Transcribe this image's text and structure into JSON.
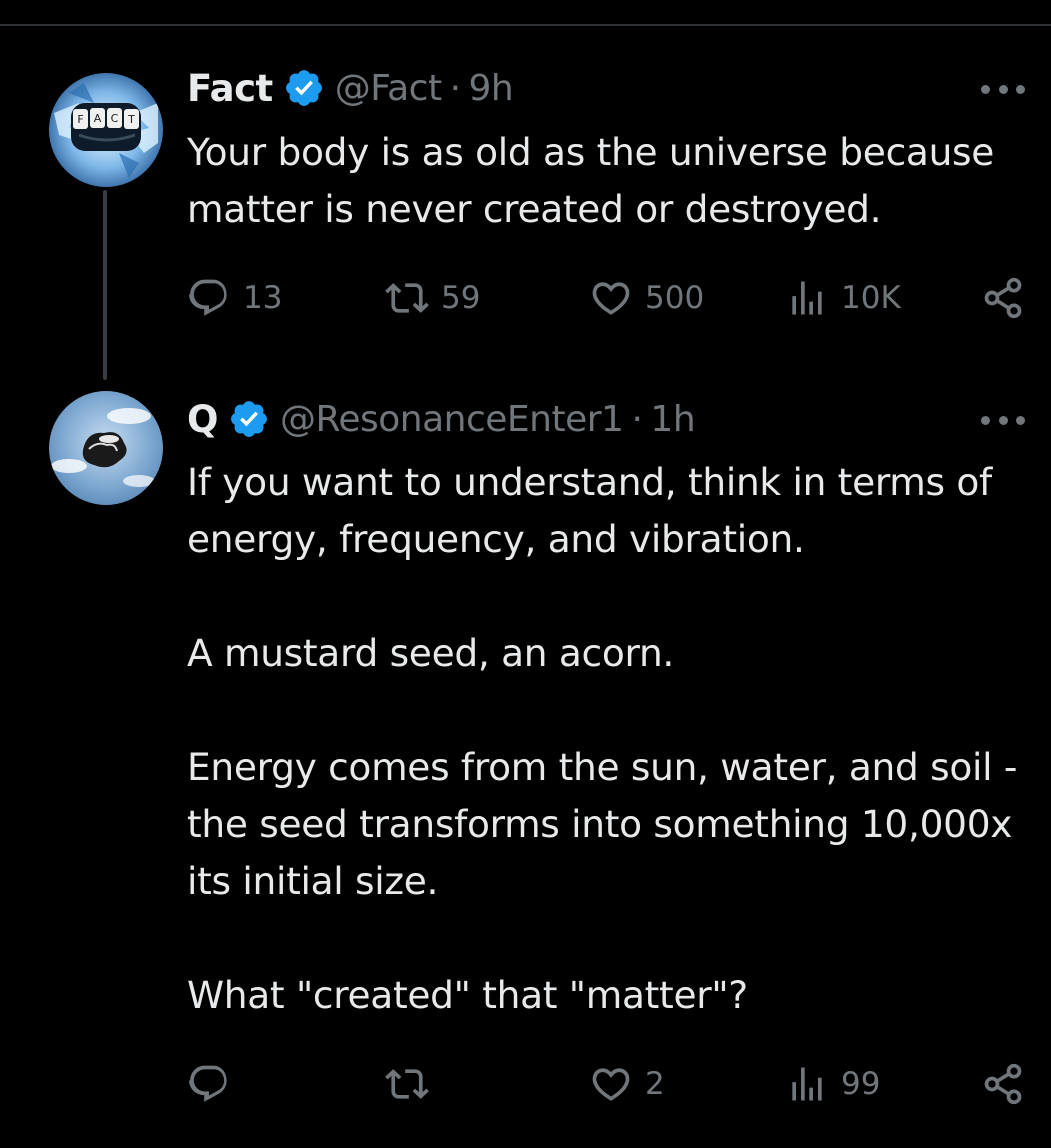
{
  "tweets": [
    {
      "name": "Fact",
      "handle": "@Fact",
      "separator": "·",
      "time": "9h",
      "text": "Your body is as old as the universe because matter is never created or destroyed.",
      "avatar": {
        "icon": "fist-fact-avatar",
        "label": "FACT"
      },
      "stats": {
        "replies": "13",
        "reposts": "59",
        "likes": "500",
        "views": "10K"
      }
    },
    {
      "name": "Q",
      "handle": "@ResonanceEnter1",
      "separator": "·",
      "time": "1h",
      "text": "If you want to understand, think in terms of energy, frequency, and vibration.\n\nA mustard seed, an acorn.\n\nEnergy comes from the sun, water, and soil - the seed transforms into something 10,000x its initial size.\n\nWhat \"created\" that \"matter\"?",
      "avatar": {
        "icon": "sky-clouds-avatar"
      },
      "stats": {
        "replies": "",
        "reposts": "",
        "likes": "2",
        "views": "99"
      }
    }
  ],
  "colors": {
    "background": "#000000",
    "text": "#e7e9ea",
    "muted": "#71767b",
    "verified": "#1d9bf0",
    "divider": "#2f3336"
  }
}
